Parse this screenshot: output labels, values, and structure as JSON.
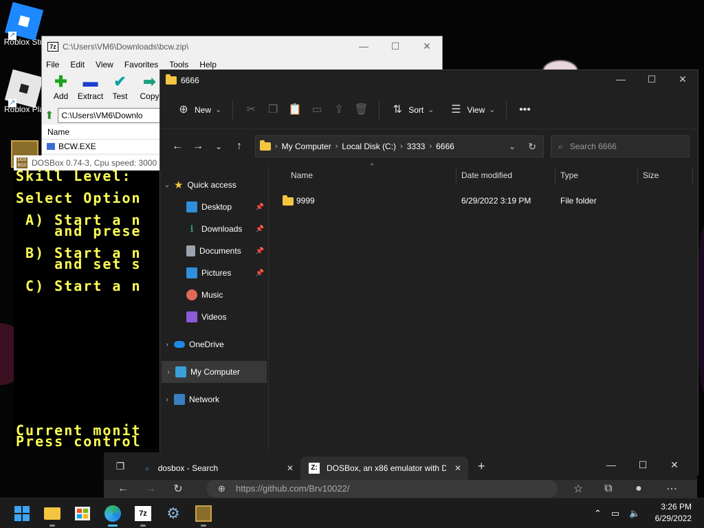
{
  "desktop": {
    "icons": [
      {
        "label": "Roblox Stu"
      },
      {
        "label": "Roblox Pla"
      }
    ]
  },
  "zip": {
    "title": "C:\\Users\\VM6\\Downloads\\bcw.zip\\",
    "app_icon": "7z",
    "menu": [
      "File",
      "Edit",
      "View",
      "Favorites",
      "Tools",
      "Help"
    ],
    "tools": [
      {
        "label": "Add",
        "icon": "plus-icon",
        "color": "#1aa31a"
      },
      {
        "label": "Extract",
        "icon": "minus-icon",
        "color": "#1a3fd0"
      },
      {
        "label": "Test",
        "icon": "check-icon",
        "color": "#0aa0a0"
      },
      {
        "label": "Copy",
        "icon": "arrow-right-icon",
        "color": "#1aa080"
      }
    ],
    "address": "C:\\Users\\VM6\\Downlo",
    "column": "Name",
    "file": "BCW.EXE"
  },
  "dosbox": {
    "title": "DOSBox 0.74-3, Cpu speed:   3000",
    "screen": "Skill Level:\n\nSelect Option\n\n A) Start a n\n    and prese\n\n B) Start a n\n    and set s\n\n C) Start a n",
    "footer": "Current monit\nPress control",
    "text_color": "#ffff55"
  },
  "explorer": {
    "title": "6666",
    "commands": {
      "new": "New",
      "sort": "Sort",
      "view": "View"
    },
    "breadcrumb": [
      "My Computer",
      "Local Disk (C:)",
      "3333",
      "6666"
    ],
    "search_placeholder": "Search 6666",
    "nav": {
      "quick_access": "Quick access",
      "items": [
        {
          "label": "Desktop",
          "pinned": true,
          "color": "#2f8fdc"
        },
        {
          "label": "Downloads",
          "pinned": true,
          "color": "#2fb46a"
        },
        {
          "label": "Documents",
          "pinned": true,
          "color": "#9aa3ad"
        },
        {
          "label": "Pictures",
          "pinned": true,
          "color": "#2f8fdc"
        },
        {
          "label": "Music",
          "pinned": false,
          "color": "#e06a5a"
        },
        {
          "label": "Videos",
          "pinned": false,
          "color": "#8a5ad8"
        }
      ],
      "onedrive": "OneDrive",
      "my_computer": "My Computer",
      "network": "Network"
    },
    "columns": {
      "name": "Name",
      "date": "Date modified",
      "type": "Type",
      "size": "Size"
    },
    "rows": [
      {
        "name": "9999",
        "date": "6/29/2022 3:19 PM",
        "type": "File folder",
        "size": ""
      }
    ]
  },
  "edge": {
    "tabs": [
      {
        "label": "dosbox - Search",
        "active": false
      },
      {
        "label": "DOSBox, an x86 emulator with D",
        "active": true
      }
    ],
    "url": "https://github.com/Brv10022/"
  },
  "taskbar": {
    "apps": [
      "start",
      "file-explorer",
      "store",
      "edge",
      "7zip",
      "settings",
      "dosbox"
    ],
    "time": "3:26 PM",
    "date": "6/29/2022"
  }
}
